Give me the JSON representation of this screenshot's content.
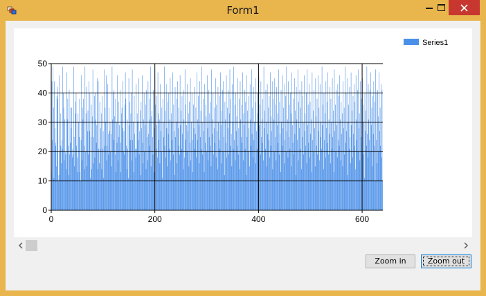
{
  "window": {
    "title": "Form1",
    "controls": {
      "minimize": "minimize-icon",
      "maximize": "maximize-icon",
      "close": "close-icon"
    }
  },
  "buttons": {
    "zoom_in": "Zoom in",
    "zoom_out": "Zoom out"
  },
  "colors": {
    "series": "#4a8fe8",
    "frame": "#e9b54d",
    "close": "#c7372f"
  },
  "chart_data": {
    "type": "bar",
    "title": "",
    "xlabel": "",
    "ylabel": "",
    "xlim": [
      0,
      640
    ],
    "ylim": [
      0,
      50
    ],
    "x_ticks": [
      0,
      200,
      400,
      600
    ],
    "y_ticks": [
      0,
      10,
      20,
      30,
      40,
      50
    ],
    "grid": true,
    "legend": "top-right",
    "series": [
      {
        "name": "Series1",
        "color": "#4a8fe8",
        "values": [
          13,
          44,
          24,
          49,
          35,
          11,
          44,
          28,
          23,
          22,
          15,
          39,
          38,
          42,
          10,
          12,
          46,
          20,
          33,
          22,
          16,
          24,
          21,
          49,
          40,
          35,
          17,
          31,
          20,
          19,
          14,
          47,
          31,
          38,
          22,
          12,
          41,
          19,
          23,
          35,
          28,
          35,
          18,
          21,
          19,
          49,
          25,
          15,
          33,
          37,
          40,
          22,
          18,
          13,
          33,
          30,
          25,
          38,
          13,
          10,
          24,
          46,
          17,
          35,
          31,
          38,
          22,
          14,
          49,
          20,
          33,
          42,
          15,
          27,
          34,
          19,
          44,
          27,
          40,
          11,
          25,
          36,
          14,
          32,
          48,
          16,
          25,
          39,
          18,
          40,
          31,
          23,
          29,
          45,
          14,
          44,
          21,
          16,
          37,
          21,
          28,
          33,
          14,
          39,
          21,
          27,
          11,
          48,
          22,
          35,
          30,
          46,
          17,
          22,
          43,
          26,
          19,
          35,
          27,
          30,
          20,
          26,
          15,
          49,
          31,
          40,
          24,
          41,
          32,
          19,
          38,
          13,
          30,
          23,
          46,
          17,
          37,
          25,
          29,
          41,
          23,
          13,
          33,
          35,
          28,
          44,
          20,
          27,
          19,
          36,
          47,
          38,
          22,
          14,
          31,
          21,
          11,
          45,
          29,
          37,
          24,
          33,
          40,
          17,
          48,
          24,
          30,
          13,
          39,
          26,
          21,
          18,
          43,
          21,
          33,
          30,
          24,
          45,
          19,
          27,
          34,
          12,
          37,
          28,
          46,
          23,
          16,
          31,
          40,
          20,
          29,
          36,
          14,
          41,
          25,
          17,
          44,
          26,
          31,
          38,
          22,
          49,
          15,
          32,
          34,
          25,
          19,
          41,
          13,
          28,
          46,
          36,
          21,
          39,
          29,
          18,
          47,
          33,
          24,
          31,
          16,
          43,
          27,
          20,
          35,
          11,
          38,
          30,
          25,
          49,
          22,
          34,
          18,
          43,
          28,
          15,
          37,
          26,
          40,
          21,
          31,
          45,
          17,
          33,
          30,
          24,
          47,
          19,
          36,
          27,
          12,
          42,
          25,
          30,
          38,
          16,
          44,
          28,
          35,
          22,
          19,
          46,
          29,
          34,
          21,
          39,
          26,
          14,
          41,
          31,
          18,
          48,
          24,
          36,
          29,
          20,
          43,
          27,
          33,
          15,
          37,
          23,
          45,
          17,
          30,
          40,
          24,
          13,
          36,
          28,
          42,
          21,
          26,
          35,
          18,
          47,
          24,
          31,
          39,
          29,
          16,
          44,
          25,
          34,
          21,
          49,
          30,
          19,
          38,
          27,
          13,
          43,
          23,
          36,
          32,
          20,
          46,
          28,
          17,
          41,
          25,
          33,
          22,
          37,
          15,
          48,
          26,
          31,
          40,
          19,
          28,
          35,
          23,
          45,
          18,
          36,
          27,
          14,
          42,
          30,
          24,
          39,
          21,
          47,
          29,
          16,
          34,
          41,
          20,
          44,
          25,
          12,
          37,
          31,
          23,
          46,
          18,
          35,
          28,
          41,
          19,
          33,
          48,
          22,
          38,
          26,
          15,
          43,
          30,
          21,
          49,
          24,
          36,
          17,
          40,
          27,
          32,
          22,
          45,
          19,
          28,
          38,
          14,
          44,
          31,
          25,
          36,
          23,
          47,
          17,
          33,
          29,
          41,
          21,
          37,
          12,
          46,
          25,
          34,
          20,
          39,
          28,
          15,
          43,
          31,
          22,
          48,
          26,
          35,
          18,
          42,
          24,
          30,
          37,
          16,
          45,
          27,
          21,
          40,
          33,
          13,
          46,
          29,
          36,
          19,
          44,
          25,
          31,
          23,
          38,
          17,
          49,
          28,
          34,
          21,
          41,
          30,
          15,
          43,
          26,
          35,
          24,
          39,
          18,
          47,
          22,
          32,
          27,
          44,
          14,
          38,
          31,
          20,
          45,
          25,
          36,
          17,
          42,
          29,
          33,
          23,
          48,
          19,
          37,
          26,
          13,
          41,
          30,
          22,
          46,
          28,
          35,
          16,
          43,
          24,
          39,
          20,
          49,
          27,
          31,
          18,
          44,
          25,
          36,
          21,
          40,
          33,
          15,
          47,
          29,
          23,
          38,
          19,
          45,
          26,
          34,
          12,
          42,
          31,
          24,
          48,
          17,
          37,
          28,
          41,
          21,
          35,
          14,
          44,
          25,
          39,
          30,
          19,
          46,
          27,
          33,
          22,
          40,
          16,
          48,
          29,
          36,
          23,
          43,
          18,
          37,
          26,
          31,
          13,
          47,
          24,
          34,
          20,
          41,
          28,
          15,
          45,
          32,
          22,
          38,
          19,
          46,
          27,
          35,
          17,
          43,
          25,
          30,
          21,
          49,
          29,
          36,
          14,
          40,
          24,
          33,
          18,
          44,
          28,
          37,
          23,
          47,
          19,
          31,
          26,
          42,
          16,
          38,
          30,
          21,
          45,
          25,
          34,
          13,
          48,
          27,
          36,
          20,
          41,
          29,
          18,
          43,
          24,
          39,
          22,
          46,
          31,
          17,
          37,
          26,
          33,
          15,
          44,
          28,
          35,
          19,
          49,
          23,
          40,
          27,
          12,
          45,
          30,
          36,
          21,
          42,
          25,
          16,
          47,
          29,
          34,
          18,
          39,
          26,
          43,
          22,
          37,
          14,
          46,
          31,
          24,
          41,
          20,
          48,
          28,
          33,
          17,
          44,
          25,
          38,
          23,
          45,
          19,
          36,
          30,
          11,
          40,
          27,
          34,
          22,
          49,
          26,
          18,
          43,
          31,
          24,
          41,
          20,
          47,
          29,
          35,
          15,
          39,
          26,
          44,
          22,
          37,
          10,
          48,
          24,
          40,
          16,
          41,
          32,
          20,
          47,
          27,
          35,
          22,
          43,
          18,
          41,
          10
        ]
      }
    ]
  }
}
